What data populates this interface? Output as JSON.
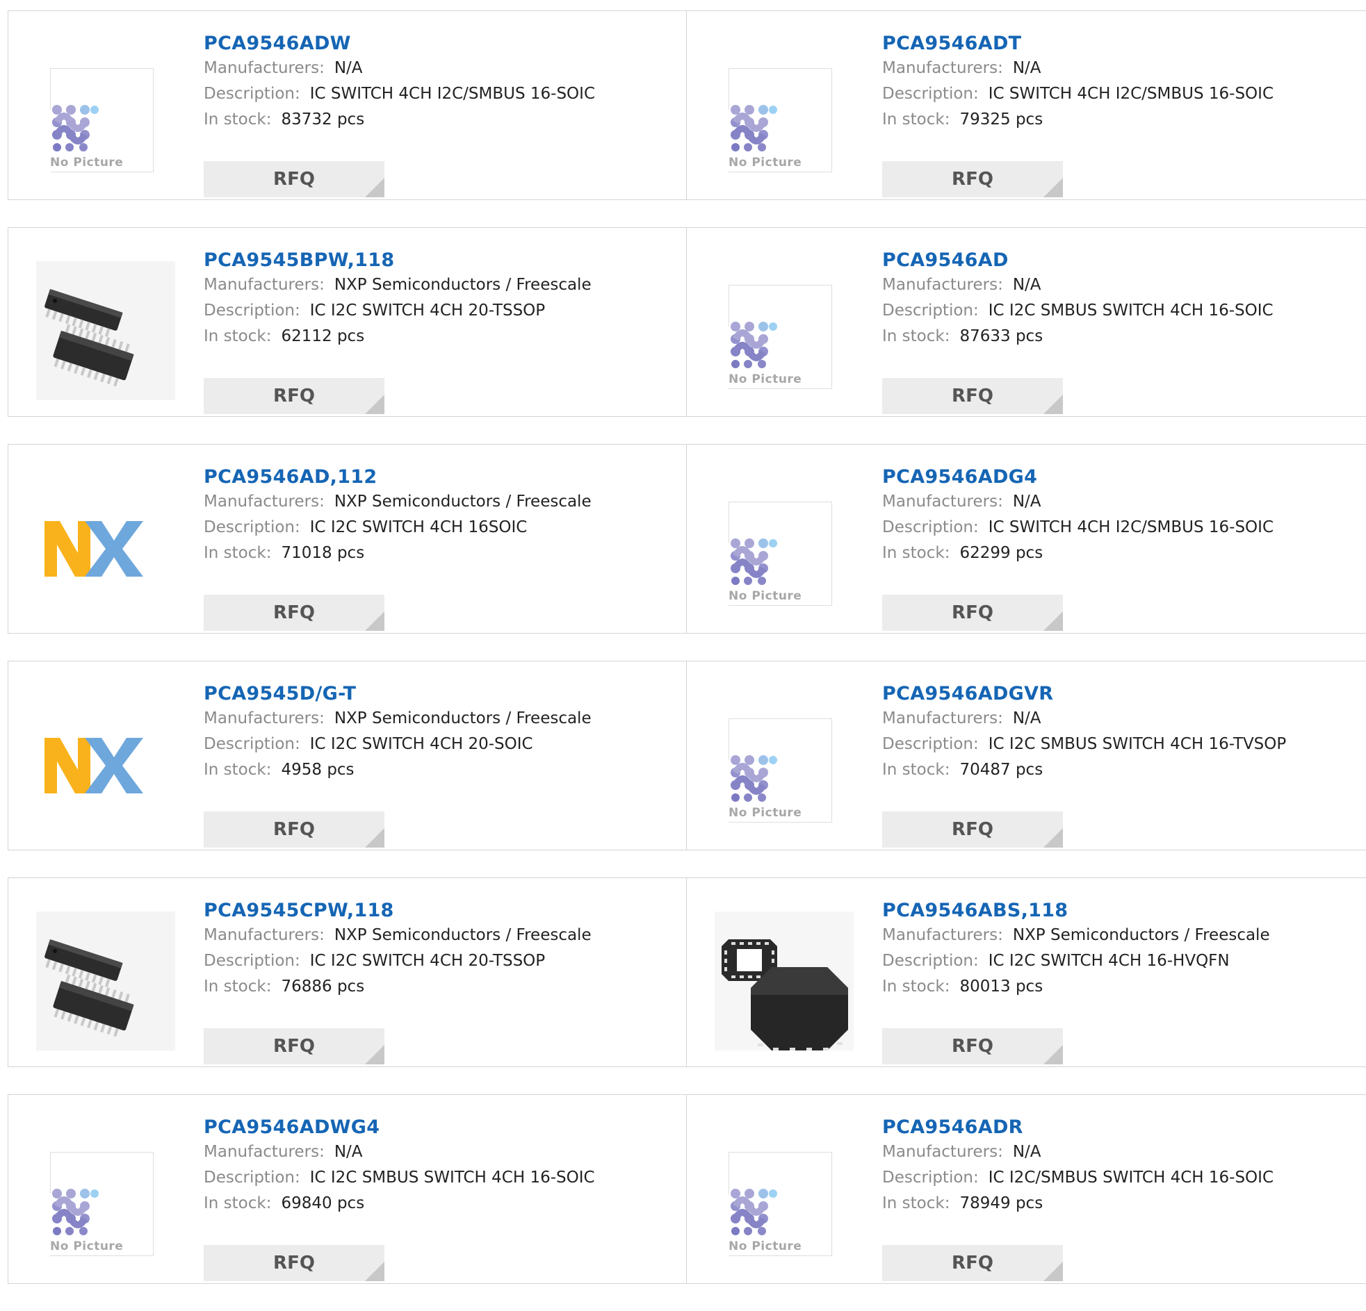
{
  "labels": {
    "manufacturers": "Manufacturers:",
    "description": "Description:",
    "stock": "In stock:",
    "rfq": "RFQ",
    "no_picture": "No Picture"
  },
  "products": [
    {
      "part": "PCA9546ADW",
      "manufacturer": "N/A",
      "description": "IC SWITCH 4CH I2C/SMBUS 16-SOIC",
      "stock": "83732 pcs",
      "image": "no-picture"
    },
    {
      "part": "PCA9546ADT",
      "manufacturer": "N/A",
      "description": "IC SWITCH 4CH I2C/SMBUS 16-SOIC",
      "stock": "79325 pcs",
      "image": "no-picture"
    },
    {
      "part": "PCA9545BPW,118",
      "manufacturer": "NXP Semiconductors / Freescale",
      "description": "IC I2C SWITCH 4CH 20-TSSOP",
      "stock": "62112 pcs",
      "image": "tssop-chip"
    },
    {
      "part": "PCA9546AD",
      "manufacturer": "N/A",
      "description": "IC I2C SMBUS SWITCH 4CH 16-SOIC",
      "stock": "87633 pcs",
      "image": "no-picture"
    },
    {
      "part": "PCA9546AD,112",
      "manufacturer": "NXP Semiconductors / Freescale",
      "description": "IC I2C SWITCH 4CH 16SOIC",
      "stock": "71018 pcs",
      "image": "nxp-logo"
    },
    {
      "part": "PCA9546ADG4",
      "manufacturer": "N/A",
      "description": "IC SWITCH 4CH I2C/SMBUS 16-SOIC",
      "stock": "62299 pcs",
      "image": "no-picture"
    },
    {
      "part": "PCA9545D/G-T",
      "manufacturer": "NXP Semiconductors / Freescale",
      "description": "IC I2C SWITCH 4CH 20-SOIC",
      "stock": "4958 pcs",
      "image": "nxp-logo"
    },
    {
      "part": "PCA9546ADGVR",
      "manufacturer": "N/A",
      "description": "IC I2C SMBUS SWITCH 4CH 16-TVSOP",
      "stock": "70487 pcs",
      "image": "no-picture"
    },
    {
      "part": "PCA9545CPW,118",
      "manufacturer": "NXP Semiconductors / Freescale",
      "description": "IC I2C SWITCH 4CH 20-TSSOP",
      "stock": "76886 pcs",
      "image": "tssop-chip"
    },
    {
      "part": "PCA9546ABS,118",
      "manufacturer": "NXP Semiconductors / Freescale",
      "description": "IC I2C SWITCH 4CH 16-HVQFN",
      "stock": "80013 pcs",
      "image": "qfn-chip"
    },
    {
      "part": "PCA9546ADWG4",
      "manufacturer": "N/A",
      "description": "IC I2C SMBUS SWITCH 4CH 16-SOIC",
      "stock": "69840 pcs",
      "image": "no-picture"
    },
    {
      "part": "PCA9546ADR",
      "manufacturer": "N/A",
      "description": "IC I2C/SMBUS SWITCH 4CH 16-SOIC",
      "stock": "78949 pcs",
      "image": "no-picture"
    }
  ],
  "colors": {
    "link": "#1565b4",
    "label": "#8a8a8a",
    "button": "#ececec"
  }
}
